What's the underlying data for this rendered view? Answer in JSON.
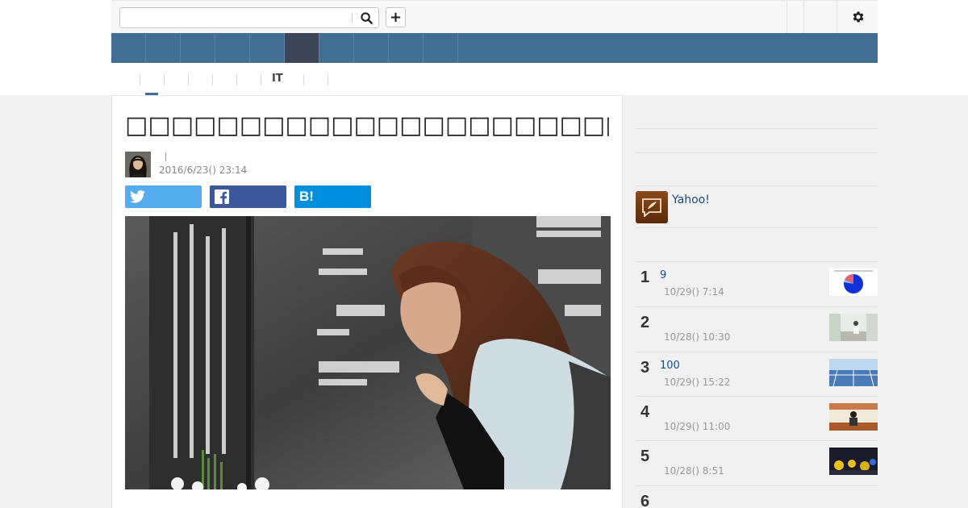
{
  "header": {
    "search": {
      "placeholder": "",
      "value": ""
    },
    "icons": {
      "search": "search-icon",
      "add": "plus-icon",
      "settings": "gear-icon"
    }
  },
  "subnav": {
    "it_label": "IT"
  },
  "article": {
    "title": "□□□□□□□□□□□□□□□□□□□□□□□□□□□□□□□□□",
    "date": "2016/6/23() 23:14",
    "share": {
      "hatena_label": "B!"
    }
  },
  "sidebar": {
    "yahoo_label": "Yahoo!",
    "ranking": [
      {
        "rank": "1",
        "title": "9",
        "time": "10/29() 7:14"
      },
      {
        "rank": "2",
        "title": "",
        "time": "10/28() 10:30"
      },
      {
        "rank": "3",
        "title": "100",
        "time": "10/29() 15:22"
      },
      {
        "rank": "4",
        "title": "",
        "time": "10/29() 11:00"
      },
      {
        "rank": "5",
        "title": "",
        "time": "10/28() 8:51"
      },
      {
        "rank": "6",
        "title": "",
        "time": ""
      }
    ]
  },
  "colors": {
    "nav": "#436e94",
    "nav_active": "#3c4556",
    "twitter": "#55acee",
    "facebook": "#3b5998",
    "hatena": "#008fde",
    "link": "#1a4a8a"
  }
}
